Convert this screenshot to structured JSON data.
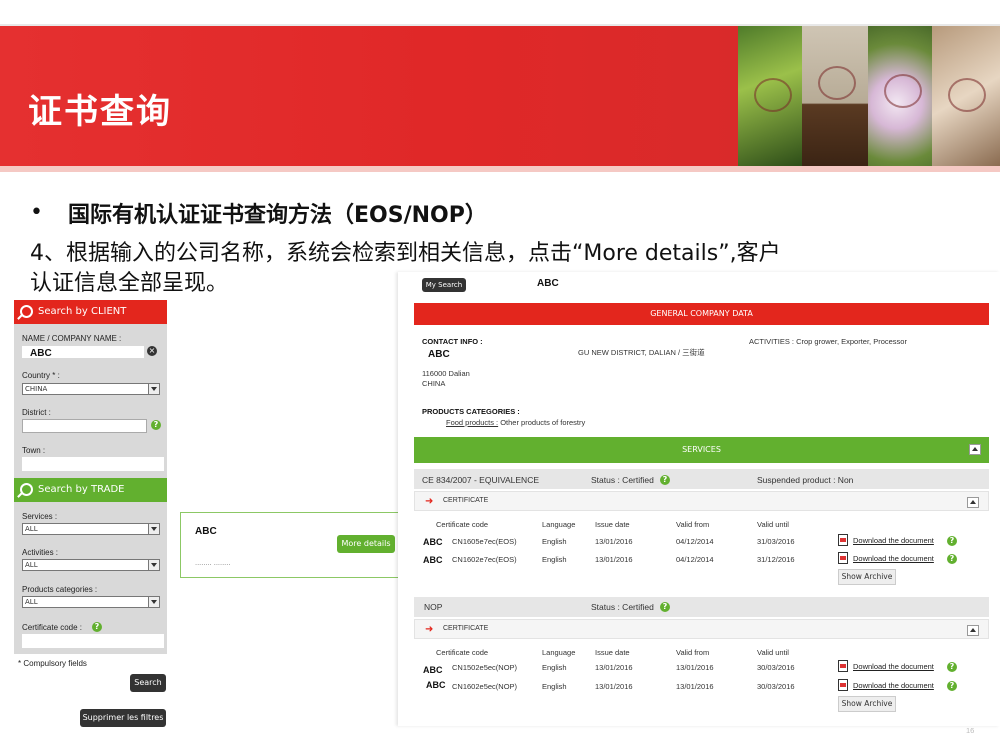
{
  "header": {
    "title": "证书查询"
  },
  "intro": {
    "bullet": "•",
    "title": "国际有机认证证书查询方法（EOS/NOP）",
    "desc_line1": "4、根据输入的公司名称，系统会检索到相关信息，点击“More details”,客户",
    "desc_line2": "认证信息全部呈现。"
  },
  "left_panel": {
    "client_header": "Search by CLIENT",
    "company_label": "NAME / COMPANY NAME :",
    "company_value": "ABC",
    "country_label": "Country * :",
    "country_value": "CHINA",
    "district_label": "District :",
    "town_label": "Town :",
    "trade_header": "Search by TRADE",
    "services_label": "Services :",
    "services_value": "ALL",
    "activities_label": "Activities :",
    "activities_value": "ALL",
    "products_label": "Products categories :",
    "products_value": "ALL",
    "certificate_label": "Certificate code :",
    "compulsory": "* Compulsory fields",
    "search_button": "Search",
    "remove_filters_button": "Supprimer les filtres"
  },
  "result_card": {
    "name": "ABC",
    "sub": "........ ........",
    "more_details_button": "More details"
  },
  "detail": {
    "my_search_button": "My Search",
    "company": "ABC",
    "general_header": "GENERAL COMPANY DATA",
    "contact_label": "CONTACT INFO :",
    "contact_name": "ABC",
    "contact_addr1": "116000 Dalian",
    "contact_addr2": "CHINA",
    "district_text": "GU NEW DISTRICT, DALIAN / 三街道",
    "activities_text": "ACTIVITIES : Crop grower, Exporter, Processor",
    "products_label": "PRODUCTS CATEGORIES :",
    "products_link": "Food products :",
    "products_rest": "Other products of forestry",
    "services_header": "SERVICES",
    "service1": {
      "name": "CE 834/2007 - EQUIVALENCE",
      "status": "Status : Certified",
      "suspended": "Suspended product : Non",
      "cert_tab": "CERTIFICATE",
      "columns": [
        "Certificate code",
        "Language",
        "Issue date",
        "Valid from",
        "Valid until"
      ],
      "rows": [
        {
          "abc": "ABC",
          "code": "CN1605e7ec(EOS)",
          "language": "English",
          "issue": "13/01/2016",
          "from": "04/12/2014",
          "until": "31/03/2016",
          "download": "Download the document"
        },
        {
          "abc": "ABC",
          "code": "CN1602e7ec(EOS)",
          "language": "English",
          "issue": "13/01/2016",
          "from": "04/12/2014",
          "until": "31/12/2016",
          "download": "Download the document"
        }
      ],
      "archive": "Show Archive"
    },
    "service2": {
      "name": "NOP",
      "status": "Status : Certified",
      "cert_tab": "CERTIFICATE",
      "columns": [
        "Certificate code",
        "Language",
        "Issue date",
        "Valid from",
        "Valid until"
      ],
      "rows": [
        {
          "abc": "ABC",
          "code": "CN1502e5ec(NOP)",
          "language": "English",
          "issue": "13/01/2016",
          "from": "13/01/2016",
          "until": "30/03/2016",
          "download": "Download the document"
        },
        {
          "abc": "ABC",
          "code": "CN1602e5ec(NOP)",
          "language": "English",
          "issue": "13/01/2016",
          "from": "13/01/2016",
          "until": "30/03/2016",
          "download": "Download the document"
        }
      ],
      "archive": "Show Archive"
    },
    "page_number": "16"
  },
  "colors": {
    "red": "#e3261d",
    "green": "#62b02f",
    "dark": "#333333"
  }
}
